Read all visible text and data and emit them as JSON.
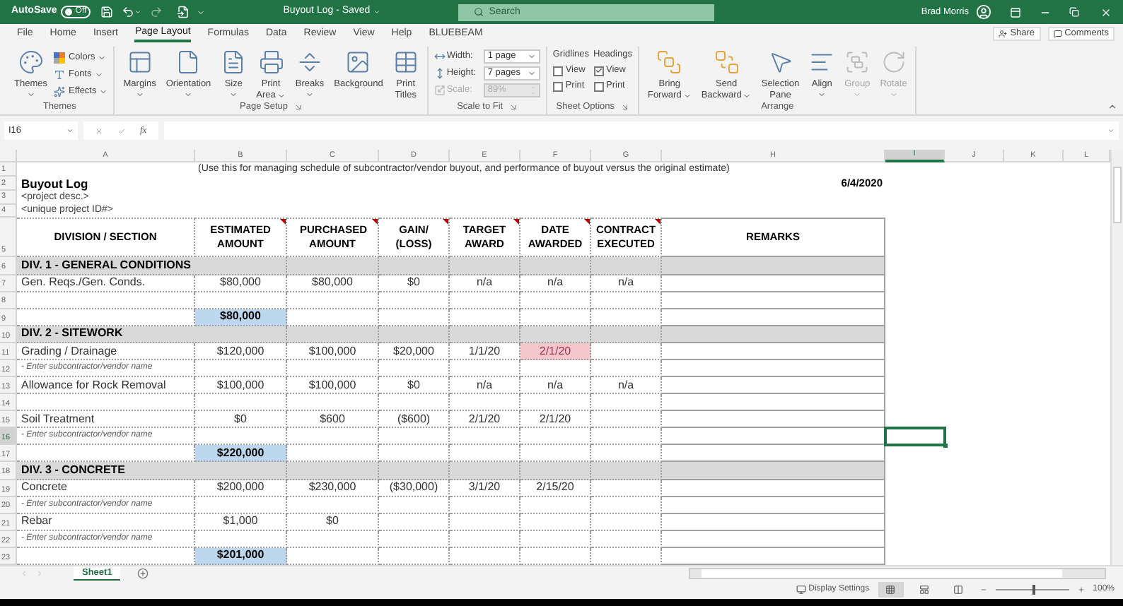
{
  "title_bar": {
    "autosave": {
      "label": "AutoSave",
      "toggle": "Off",
      "on": false
    },
    "document_title": "Buyout Log - Saved",
    "search": {
      "placeholder": "Search"
    },
    "user": "Brad Morris"
  },
  "ribbon_tabs": [
    {
      "label": "File",
      "selected": false
    },
    {
      "label": "Home",
      "selected": false
    },
    {
      "label": "Insert",
      "selected": false
    },
    {
      "label": "Page Layout",
      "selected": true
    },
    {
      "label": "Formulas",
      "selected": false
    },
    {
      "label": "Data",
      "selected": false
    },
    {
      "label": "Review",
      "selected": false
    },
    {
      "label": "View",
      "selected": false
    },
    {
      "label": "Help",
      "selected": false
    },
    {
      "label": "BLUEBEAM",
      "selected": false
    }
  ],
  "share_button": "Share",
  "comments_button": "Comments",
  "ribbon_groups": [
    {
      "label": "Themes",
      "launcher": false,
      "controls": [
        {
          "kind": "big",
          "lines": [
            "Themes"
          ],
          "dropdown": true,
          "disabled": false
        },
        {
          "kind": "stack",
          "items": [
            {
              "label": "Colors",
              "dropdown": true
            },
            {
              "label": "Fonts",
              "dropdown": true
            },
            {
              "label": "Effects",
              "dropdown": true
            }
          ]
        }
      ]
    },
    {
      "label": "Page Setup",
      "launcher": true,
      "controls": [
        {
          "kind": "big",
          "lines": [
            "Margins"
          ],
          "dropdown": true,
          "disabled": false
        },
        {
          "kind": "big",
          "lines": [
            "Orientation"
          ],
          "dropdown": true,
          "disabled": false
        },
        {
          "kind": "big",
          "lines": [
            "Size"
          ],
          "dropdown": true,
          "disabled": false
        },
        {
          "kind": "big",
          "lines": [
            "Print",
            "Area"
          ],
          "dropdown": true,
          "disabled": false
        },
        {
          "kind": "big",
          "lines": [
            "Breaks"
          ],
          "dropdown": true,
          "disabled": false
        },
        {
          "kind": "big",
          "lines": [
            "Background"
          ],
          "dropdown": false,
          "disabled": false
        },
        {
          "kind": "big",
          "lines": [
            "Print",
            "Titles"
          ],
          "dropdown": false,
          "disabled": false
        }
      ]
    },
    {
      "label": "Scale to Fit",
      "launcher": true,
      "controls": [
        {
          "kind": "fields",
          "items": [
            {
              "label": "Width:",
              "value": "1 page",
              "kind": "dropdown",
              "disabled": false
            },
            {
              "label": "Height:",
              "value": "7 pages",
              "kind": "dropdown",
              "disabled": false
            },
            {
              "label": "Scale:",
              "value": "89%",
              "kind": "spinner",
              "disabled": true
            }
          ]
        }
      ]
    },
    {
      "label": "Sheet Options",
      "launcher": true,
      "controls": [
        {
          "kind": "options",
          "heading": "Gridlines",
          "boxes": [
            {
              "label": "View",
              "checked": false
            },
            {
              "label": "Print",
              "checked": false
            }
          ]
        },
        {
          "kind": "options",
          "heading": "Headings",
          "boxes": [
            {
              "label": "View",
              "checked": true
            },
            {
              "label": "Print",
              "checked": false
            }
          ]
        }
      ]
    },
    {
      "label": "Arrange",
      "launcher": false,
      "controls": [
        {
          "kind": "big",
          "lines": [
            "Bring",
            "Forward"
          ],
          "dropdown": true,
          "disabled": false
        },
        {
          "kind": "big",
          "lines": [
            "Send",
            "Backward"
          ],
          "dropdown": true,
          "disabled": false
        },
        {
          "kind": "big",
          "lines": [
            "Selection",
            "Pane"
          ],
          "dropdown": false,
          "disabled": false
        },
        {
          "kind": "big",
          "lines": [
            "Align"
          ],
          "dropdown": true,
          "disabled": false
        },
        {
          "kind": "big",
          "lines": [
            "Group"
          ],
          "dropdown": true,
          "disabled": true
        },
        {
          "kind": "big",
          "lines": [
            "Rotate"
          ],
          "dropdown": true,
          "disabled": true
        }
      ]
    }
  ],
  "formula_bar": {
    "name_box": "I16",
    "function_label": "fx"
  },
  "column_headers": [
    {
      "label": "A",
      "selected": false
    },
    {
      "label": "B",
      "selected": false
    },
    {
      "label": "C",
      "selected": false
    },
    {
      "label": "D",
      "selected": false
    },
    {
      "label": "E",
      "selected": false
    },
    {
      "label": "F",
      "selected": false
    },
    {
      "label": "G",
      "selected": false
    },
    {
      "label": "H",
      "selected": false
    },
    {
      "label": "I",
      "selected": true
    },
    {
      "label": "J",
      "selected": false
    },
    {
      "label": "K",
      "selected": false
    },
    {
      "label": "L",
      "selected": false
    }
  ],
  "rows": [
    {
      "number": "1",
      "selected": false,
      "kind": "note",
      "cells": {
        "B": "(Use this for managing schedule of subcontractor/vendor buyout, and performance of buyout versus the original estimate)"
      }
    },
    {
      "number": "2",
      "selected": false,
      "kind": "title",
      "cells": {
        "A": "Buyout Log",
        "H": "6/4/2020"
      }
    },
    {
      "number": "3",
      "selected": false,
      "kind": "sub",
      "cells": {
        "A": "<project desc.>"
      }
    },
    {
      "number": "4",
      "selected": false,
      "kind": "sub",
      "cells": {
        "A": "<unique project ID#>"
      }
    },
    {
      "number": "5",
      "selected": false,
      "kind": "header",
      "cells": {
        "A": {
          "text": "DIVISION / SECTION",
          "comment": false
        },
        "B": {
          "text": "ESTIMATED AMOUNT",
          "comment": true
        },
        "C": {
          "text": "PURCHASED AMOUNT",
          "comment": true
        },
        "D": {
          "text": "GAIN/ (LOSS)",
          "comment": true
        },
        "E": {
          "text": "TARGET AWARD",
          "comment": true
        },
        "F": {
          "text": "DATE AWARDED",
          "comment": true
        },
        "G": {
          "text": "CONTRACT EXECUTED",
          "comment": true
        },
        "H": {
          "text": "REMARKS",
          "comment": false
        }
      }
    },
    {
      "number": "6",
      "selected": false,
      "kind": "section",
      "cells": {
        "A": "DIV. 1 - GENERAL CONDITIONS"
      }
    },
    {
      "number": "7",
      "selected": false,
      "kind": "item",
      "cells": {
        "A": "Gen. Reqs./Gen. Conds.",
        "B": "$80,000",
        "C": "$80,000",
        "D": "$0",
        "E": "n/a",
        "F": "n/a",
        "G": "n/a"
      }
    },
    {
      "number": "8",
      "selected": false,
      "kind": "blank"
    },
    {
      "number": "9",
      "selected": false,
      "kind": "total",
      "cells": {
        "B": "$80,000"
      }
    },
    {
      "number": "10",
      "selected": false,
      "kind": "section",
      "cells": {
        "A": "DIV. 2 - SITEWORK"
      }
    },
    {
      "number": "11",
      "selected": false,
      "kind": "item",
      "cells": {
        "A": "Grading / Drainage",
        "B": "$120,000",
        "C": "$100,000",
        "D": "$20,000",
        "E": "1/1/20",
        "F": {
          "text": "2/1/20",
          "highlighted": true
        }
      }
    },
    {
      "number": "12",
      "selected": false,
      "kind": "hint",
      "cells": {
        "A": "- Enter subcontractor/vendor name"
      }
    },
    {
      "number": "13",
      "selected": false,
      "kind": "item",
      "cells": {
        "A": "Allowance for Rock Removal",
        "B": "$100,000",
        "C": "$100,000",
        "D": "$0",
        "E": "n/a",
        "F": "n/a",
        "G": "n/a"
      }
    },
    {
      "number": "14",
      "selected": false,
      "kind": "blank"
    },
    {
      "number": "15",
      "selected": false,
      "kind": "item",
      "cells": {
        "A": "Soil Treatment",
        "B": "$0",
        "C": "$600",
        "D": "($600)",
        "E": "2/1/20",
        "F": "2/1/20"
      }
    },
    {
      "number": "16",
      "selected": true,
      "kind": "hint",
      "cells": {
        "A": "- Enter subcontractor/vendor name"
      }
    },
    {
      "number": "17",
      "selected": false,
      "kind": "total",
      "cells": {
        "B": "$220,000"
      }
    },
    {
      "number": "18",
      "selected": false,
      "kind": "section",
      "cells": {
        "A": "DIV. 3 - CONCRETE"
      }
    },
    {
      "number": "19",
      "selected": false,
      "kind": "item",
      "cells": {
        "A": "Concrete",
        "B": "$200,000",
        "C": "$230,000",
        "D": "($30,000)",
        "E": "3/1/20",
        "F": "2/15/20"
      }
    },
    {
      "number": "20",
      "selected": false,
      "kind": "hint",
      "cells": {
        "A": "- Enter subcontractor/vendor name"
      }
    },
    {
      "number": "21",
      "selected": false,
      "kind": "item",
      "cells": {
        "A": "Rebar",
        "B": "$1,000",
        "C": "$0"
      }
    },
    {
      "number": "22",
      "selected": false,
      "kind": "hint",
      "cells": {
        "A": "- Enter subcontractor/vendor name"
      }
    },
    {
      "number": "23",
      "selected": false,
      "kind": "total",
      "cells": {
        "B": "$201,000"
      }
    }
  ],
  "sheet_tabs": [
    {
      "label": "Sheet1",
      "selected": true
    }
  ],
  "status_bar": {
    "display_settings": "Display Settings",
    "view_buttons": [
      {
        "selected": true
      },
      {
        "selected": false
      },
      {
        "selected": false
      }
    ],
    "zoom": {
      "level": 0.5,
      "reading": "100%"
    }
  }
}
